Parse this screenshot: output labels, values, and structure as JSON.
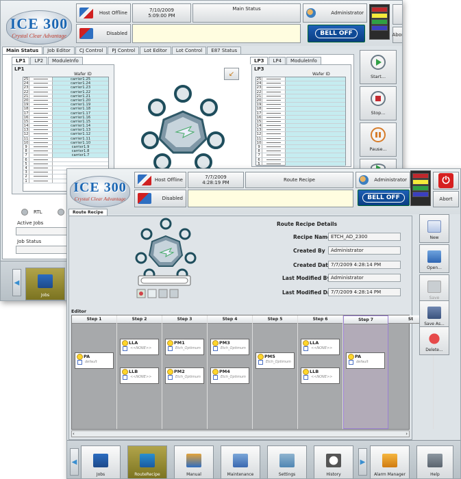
{
  "back": {
    "logo": {
      "title": "ICE 300",
      "subtitle": "Crystal Clear Advantage"
    },
    "host_status": "Host Offline",
    "disabled": "Disabled",
    "date": "7/10/2009",
    "time": "5:09:00 PM",
    "screen_title": "Main Status",
    "user": "Administrator",
    "abort": "Abort",
    "bell": "BELL OFF",
    "main_tabs": [
      "Main Status",
      "Job Editor",
      "CJ Control",
      "PJ Control",
      "Lot Editor",
      "Lot Control",
      "E87 Status"
    ],
    "left_tabs": [
      "LP1",
      "LP2",
      "ModuleInfo"
    ],
    "right_tabs": [
      "LP3",
      "LP4",
      "ModuleInfo"
    ],
    "lp1_title": "LP1",
    "lp3_title": "LP3",
    "wafer_id_header": "Wafer ID",
    "slots": [
      "25",
      "24",
      "23",
      "22",
      "21",
      "20",
      "19",
      "18",
      "17",
      "16",
      "15",
      "14",
      "13",
      "12",
      "11",
      "10",
      "9",
      "8",
      "7",
      "6",
      "5",
      "4",
      "3",
      "2",
      "1"
    ],
    "lp1_wafers": [
      "carrier1.25",
      "carrier1.24",
      "carrier1.23",
      "carrier1.22",
      "carrier1.21",
      "carrier1.20",
      "carrier1.19",
      "carrier1.18",
      "carrier1.17",
      "carrier1.16",
      "carrier1.15",
      "carrier1.14",
      "carrier1.13",
      "carrier1.12",
      "carrier1.11",
      "carrier1.10",
      "carrier1.9",
      "carrier1.8",
      "carrier1.7"
    ],
    "rtl": "RTL",
    "active_jobs": "Active Jobs",
    "job_status": "Job Status",
    "side_buttons": [
      "Start...",
      "Stop...",
      "Pause..."
    ],
    "jobs_button": "Jobs"
  },
  "front": {
    "logo": {
      "title": "ICE 300",
      "subtitle": "Crystal Clear Advantage"
    },
    "host_status": "Host Offline",
    "disabled": "Disabled",
    "date": "7/7/2009",
    "time": "4:28:19 PM",
    "screen_title": "Route Recipe",
    "user": "Administrator",
    "abort": "Abort",
    "bell": "BELL OFF",
    "tab": "Route Recipe",
    "details_title": "Route Recipe Details",
    "details": [
      {
        "label": "Recipe Name",
        "value": "ETCH_AD_2300"
      },
      {
        "label": "Created By",
        "value": "Administrator"
      },
      {
        "label": "Created Date",
        "value": "7/7/2009 4:28:14 PM"
      },
      {
        "label": "Last Modified By",
        "value": "Administrator"
      },
      {
        "label": "Last Modified Date",
        "value": "7/7/2009 4:28:14 PM"
      }
    ],
    "editor_label": "Editor",
    "steps": [
      "Step 1",
      "Step 2",
      "Step 3",
      "Step 4",
      "Step 5",
      "Step 6",
      "Step 7",
      "St"
    ],
    "nodes": {
      "pa1": {
        "name": "PA",
        "sub": "default"
      },
      "lla": {
        "name": "LLA",
        "sub": "<<NONE>>"
      },
      "llb": {
        "name": "LLB",
        "sub": "<<NONE>>"
      },
      "pm1": {
        "name": "PM1",
        "sub": "Etch_Optimum"
      },
      "pm2": {
        "name": "PM2",
        "sub": "Etch_Optimum"
      },
      "pm3": {
        "name": "PM3",
        "sub": "Etch_Optimum"
      },
      "pm4": {
        "name": "PM4",
        "sub": "Etch_Optimum"
      },
      "pm5": {
        "name": "PM5",
        "sub": "Etch_Optimum"
      },
      "lla2": {
        "name": "LLA",
        "sub": "<<NONE>>"
      },
      "llb2": {
        "name": "LLB",
        "sub": "<<NONE>>"
      },
      "pa7": {
        "name": "PA",
        "sub": "default"
      }
    },
    "right_buttons": [
      "New",
      "Open...",
      "Save",
      "Save As...",
      "Delete..."
    ],
    "nav": [
      "Jobs",
      "RouteRecipe",
      "Manual",
      "Maintenance",
      "Settings",
      "History",
      "Alarm Manager",
      "Help"
    ],
    "colors": {
      "selected_nav": "#8f8632",
      "wafer_cyan": "#c5ecf0",
      "step_selected_border": "#9b7fd4"
    }
  }
}
